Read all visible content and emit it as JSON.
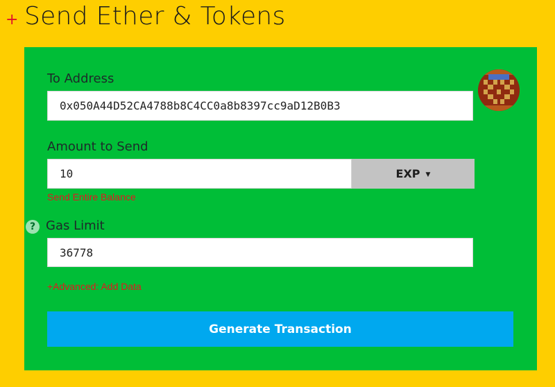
{
  "header": {
    "plus_glyph": "+",
    "title": "Send Ether & Tokens"
  },
  "form": {
    "to_address": {
      "label": "To Address",
      "value": "0x050A44D52CA4788b8C4CC0a8b8397cc9aD12B0B3"
    },
    "amount": {
      "label": "Amount to Send",
      "value": "10",
      "unit": "EXP",
      "send_entire_balance": "Send Entire Balance"
    },
    "gas": {
      "help_glyph": "?",
      "label": "Gas Limit",
      "value": "36778"
    },
    "advanced_link": "+Advanced: Add Data",
    "generate_button": "Generate Transaction"
  },
  "colors": {
    "background": "#fece00",
    "panel": "#00be37",
    "button": "#00a8ef",
    "link": "#e4161f"
  },
  "icons": {
    "avatar": "identicon-avatar",
    "help": "question-circle-icon",
    "caret": "caret-down-icon",
    "plus": "plus-icon"
  }
}
